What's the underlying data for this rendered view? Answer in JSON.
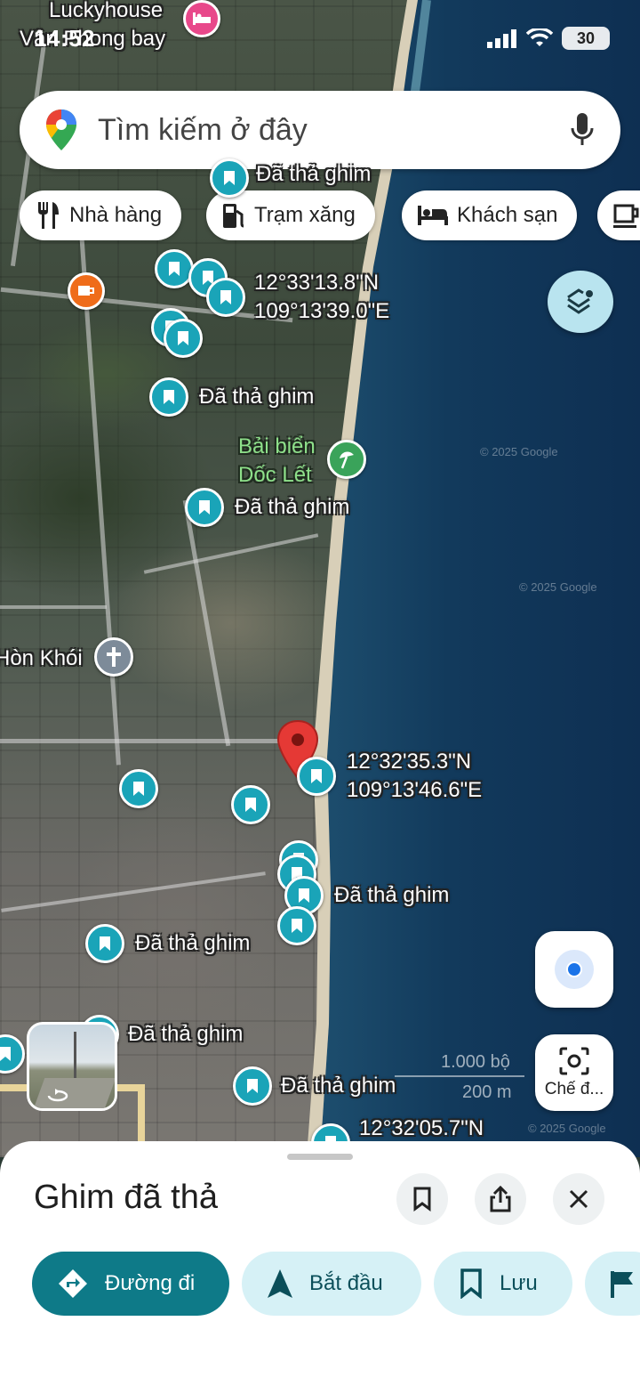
{
  "status_bar": {
    "time": "14:52",
    "battery": "30"
  },
  "search": {
    "placeholder": "Tìm kiếm ở đây"
  },
  "chips": [
    {
      "label": "Nhà hàng",
      "icon": "restaurant-icon"
    },
    {
      "label": "Trạm xăng",
      "icon": "gas-station-icon"
    },
    {
      "label": "Khách sạn",
      "icon": "hotel-icon"
    }
  ],
  "map": {
    "labels": {
      "luckyhouse": "Luckyhouse",
      "van_phong_bay": "Vân Phong bay",
      "dropped_pin": "Đã thả ghim",
      "coord1_lat": "12°33'13.8\"N",
      "coord1_lon": "109°13'39.0\"E",
      "beach_line1": "Bải biển",
      "beach_line2": "Dốc Lết",
      "hon_khoi": "Hòn Khói",
      "coord2_lat": "12°32'35.3\"N",
      "coord2_lon": "109°13'46.6\"E",
      "coord3_lat": "12°32'05.7\"N",
      "scale_ft": "1.000 bộ",
      "scale_m": "200 m",
      "copyright": "© 2025 Google"
    }
  },
  "controls": {
    "lens_label": "Chế đ..."
  },
  "sheet": {
    "title": "Ghim đã thả",
    "actions": [
      {
        "label": "Đường đi"
      },
      {
        "label": "Bắt đầu"
      },
      {
        "label": "Lưu"
      }
    ]
  },
  "colors": {
    "accent": "#0e7a88",
    "pin": "#1aa4b8",
    "red_pin": "#e53935"
  }
}
